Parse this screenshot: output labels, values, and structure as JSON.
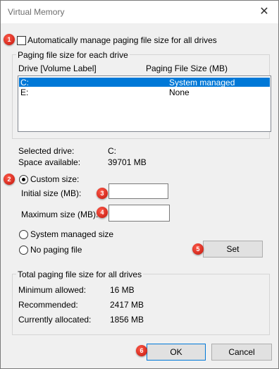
{
  "window": {
    "title": "Virtual Memory",
    "close_glyph": "✕"
  },
  "auto_manage": {
    "label": "Automatically manage paging file size for all drives",
    "checked": false
  },
  "drives_group": {
    "legend": "Paging file size for each drive",
    "col_drive": "Drive  [Volume Label]",
    "col_size": "Paging File Size (MB)",
    "rows": [
      {
        "drive": "C:",
        "size": "System managed",
        "selected": true
      },
      {
        "drive": "E:",
        "size": "None",
        "selected": false
      }
    ]
  },
  "selected_drive": {
    "label": "Selected drive:",
    "value": "C:"
  },
  "space_available": {
    "label": "Space available:",
    "value": "39701 MB"
  },
  "options": {
    "custom": "Custom size:",
    "initial_label": "Initial size (MB):",
    "initial_value": "",
    "maximum_label": "Maximum size (MB):",
    "maximum_value": "",
    "system_managed": "System managed size",
    "no_paging": "No paging file",
    "set_button": "Set"
  },
  "total_group": {
    "legend": "Total paging file size for all drives",
    "min_label": "Minimum allowed:",
    "min_value": "16 MB",
    "rec_label": "Recommended:",
    "rec_value": "2417 MB",
    "cur_label": "Currently allocated:",
    "cur_value": "1856 MB"
  },
  "buttons": {
    "ok": "OK",
    "cancel": "Cancel"
  },
  "badges": [
    "1",
    "2",
    "3",
    "4",
    "5",
    "6"
  ],
  "colors": {
    "selection": "#0078d7",
    "badge": "#d9281c"
  }
}
